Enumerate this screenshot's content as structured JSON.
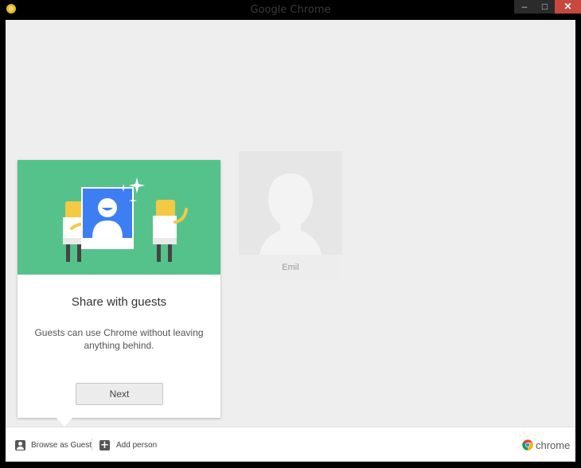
{
  "window": {
    "title": "Google Chrome",
    "minimize_glyph": "–",
    "maximize_glyph": "□",
    "close_glyph": "✕"
  },
  "guest_card": {
    "title": "Share with guests",
    "description": "Guests can use Chrome without leaving anything behind.",
    "next_label": "Next"
  },
  "profiles": [
    {
      "name": "Emil"
    }
  ],
  "bottom_bar": {
    "browse_guest_label": "Browse as Guest",
    "add_person_label": "Add person",
    "brand_text": "chrome"
  },
  "colors": {
    "banner_green": "#55c28c",
    "guest_blue": "#3d7ff3",
    "figure_yellow": "#f4c944",
    "close_red": "#c7483f"
  },
  "icons": [
    "app-icon",
    "guest-icon",
    "add-person-icon",
    "chrome-logo-icon",
    "avatar-silhouette-icon"
  ]
}
